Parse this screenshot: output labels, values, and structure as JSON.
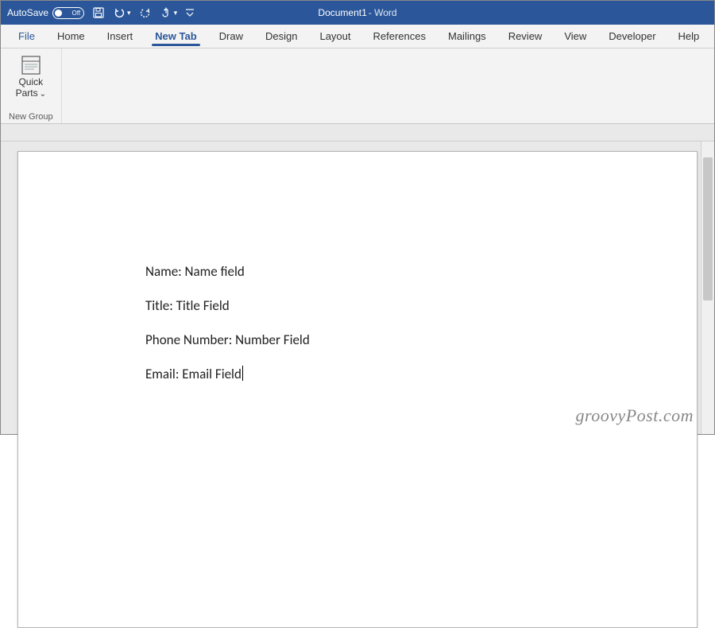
{
  "titlebar": {
    "autosave_label": "AutoSave",
    "autosave_state": "Off",
    "document_name": "Document1",
    "app_suffix": " -  Word"
  },
  "tabs": {
    "file": "File",
    "home": "Home",
    "insert": "Insert",
    "newtab": "New Tab",
    "draw": "Draw",
    "design": "Design",
    "layout": "Layout",
    "references": "References",
    "mailings": "Mailings",
    "review": "Review",
    "view": "View",
    "developer": "Developer",
    "help": "Help"
  },
  "ribbon": {
    "quick_parts_line1": "Quick",
    "quick_parts_line2": "Parts",
    "quick_parts_chev": "⌄",
    "group_label": "New Group"
  },
  "doc": {
    "lines": [
      "Name: Name field",
      "Title: Title Field",
      "Phone Number: Number Field",
      "Email: Email Field"
    ]
  },
  "watermark": "groovyPost.com"
}
